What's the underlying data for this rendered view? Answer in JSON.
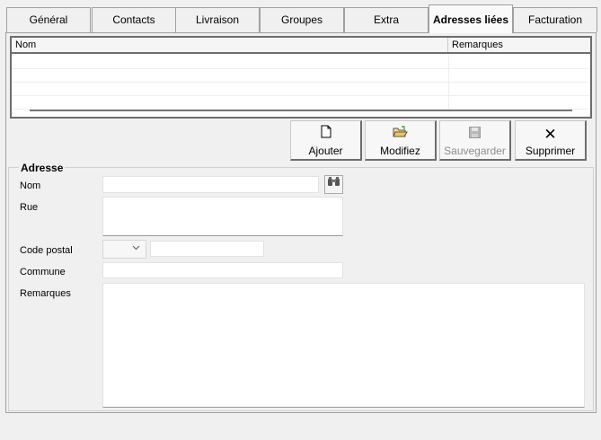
{
  "tabs": [
    {
      "label": "Général",
      "selected": false
    },
    {
      "label": "Contacts",
      "selected": false
    },
    {
      "label": "Livraison",
      "selected": false
    },
    {
      "label": "Groupes",
      "selected": false
    },
    {
      "label": "Extra",
      "selected": false
    },
    {
      "label": "Adresses liées",
      "selected": true
    },
    {
      "label": "Facturation",
      "selected": false
    }
  ],
  "grid": {
    "columns": [
      "Nom",
      "Remarques"
    ],
    "rows": []
  },
  "toolbar": {
    "add_label": "Ajouter",
    "edit_label": "Modifiez",
    "save_label": "Sauvegarder",
    "delete_label": "Supprimer",
    "save_disabled": true
  },
  "address": {
    "title": "Adresse",
    "nom_label": "Nom",
    "nom_value": "",
    "rue_label": "Rue",
    "rue_value": "",
    "code_postal_label": "Code postal",
    "code_postal_value": "",
    "code_postal_text": "",
    "commune_label": "Commune",
    "commune_value": "",
    "remarques_label": "Remarques",
    "remarques_value": ""
  },
  "icons": {
    "add": "new-document-icon",
    "edit": "open-folder-icon",
    "save": "floppy-disk-icon",
    "delete": "x-icon",
    "search": "binoculars-icon"
  }
}
